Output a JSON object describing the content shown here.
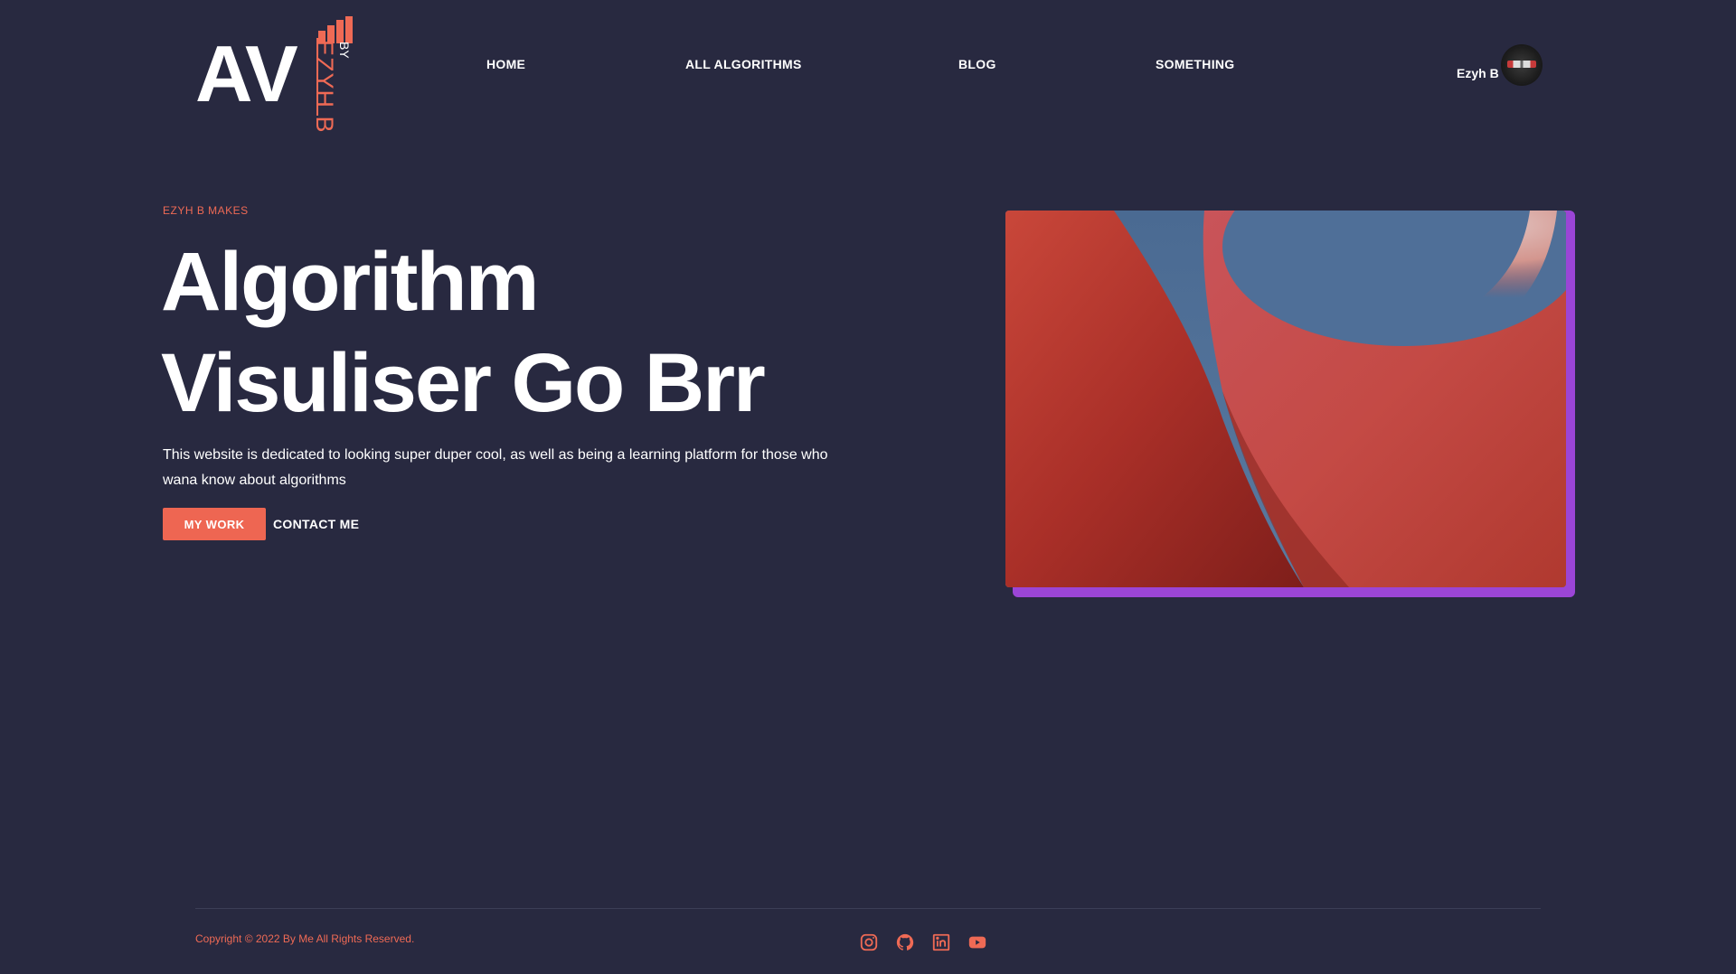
{
  "brand": {
    "logo_main": "AV",
    "logo_by": "BY",
    "logo_author": "EZYH B",
    "accent_color": "#ef6a55",
    "background_color": "#282940",
    "image_border_color": "#9b45d6"
  },
  "nav": {
    "items": [
      {
        "label": "HOME"
      },
      {
        "label": "ALL ALGORITHMS"
      },
      {
        "label": "BLOG"
      },
      {
        "label": "SOMETHING"
      }
    ]
  },
  "user": {
    "name": "Ezyh B",
    "avatar_icon": "avatar-icon"
  },
  "hero": {
    "eyebrow": "EZYH B MAKES",
    "title": "Algorithm Visuliser Go Brr",
    "description": "This website is dedicated to looking super duper cool, as well as being a learning platform for those who wana know about algorithms",
    "primary_button": "MY WORK",
    "secondary_button": "CONTACT ME"
  },
  "footer": {
    "copyright": "Copyright © 2022 By Me All Rights Reserved.",
    "socials": [
      {
        "icon": "instagram-icon"
      },
      {
        "icon": "github-icon"
      },
      {
        "icon": "linkedin-icon"
      },
      {
        "icon": "youtube-icon"
      }
    ]
  }
}
